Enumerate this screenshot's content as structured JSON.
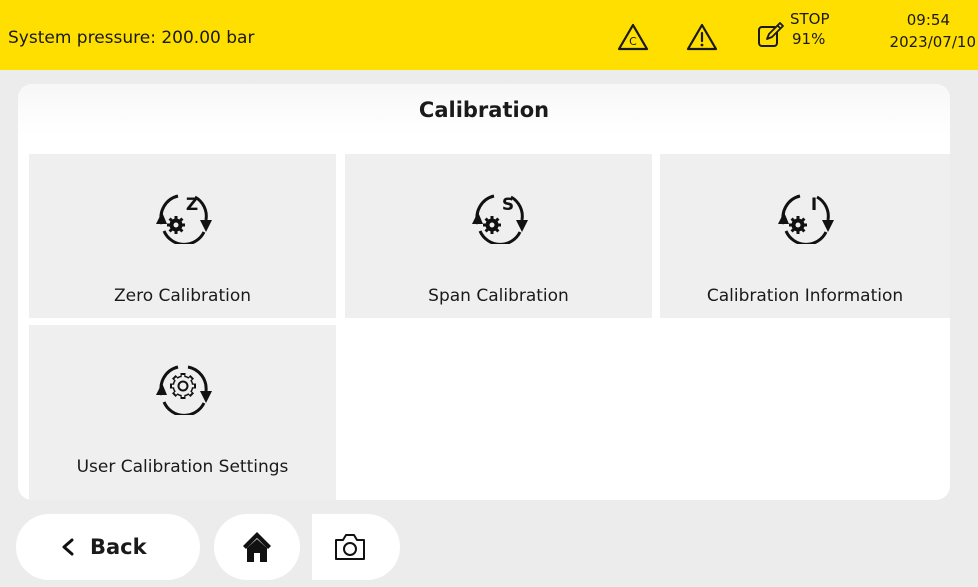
{
  "status_bar": {
    "pressure_text": "System pressure: 200.00 bar",
    "calibration_indicator_letter": "C",
    "run_state": "STOP",
    "run_percent": "91%",
    "time": "09:54",
    "date": "2023/07/10",
    "background_color": "#ffdf00",
    "icons": [
      "calibration-warning-icon",
      "warning-icon",
      "edit-icon"
    ]
  },
  "page": {
    "title": "Calibration"
  },
  "tiles": [
    {
      "label": "Zero Calibration",
      "icon": "zero-calibration-icon",
      "icon_letter": "Z"
    },
    {
      "label": "Span Calibration",
      "icon": "span-calibration-icon",
      "icon_letter": "S"
    },
    {
      "label": "Calibration Information",
      "icon": "calibration-information-icon",
      "icon_letter": "I"
    },
    {
      "label": "User Calibration Settings",
      "icon": "user-calibration-settings-icon",
      "icon_letter": ""
    }
  ],
  "nav": {
    "back_label": "Back",
    "home_icon": "home-icon",
    "screenshot_icon": "camera-icon"
  }
}
